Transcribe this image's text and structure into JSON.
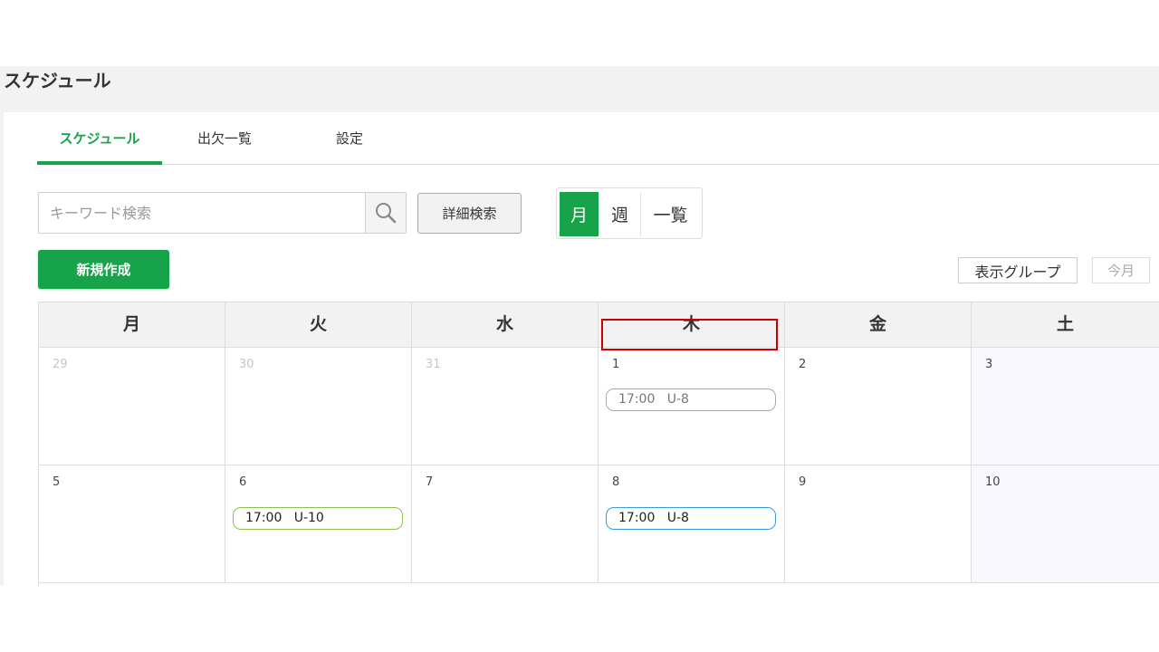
{
  "page": {
    "title": "スケジュール"
  },
  "tabs": [
    {
      "label": "スケジュール",
      "active": true
    },
    {
      "label": "出欠一覧",
      "active": false
    },
    {
      "label": "設定",
      "active": false
    }
  ],
  "search": {
    "placeholder": "キーワード検索",
    "value": "",
    "icon": "search-icon"
  },
  "toolbar": {
    "detail_search_label": "詳細検索",
    "new_label": "新規作成",
    "display_group_label": "表示グループ",
    "today_label": "今月"
  },
  "view_toggle": [
    {
      "label": "月",
      "active": true
    },
    {
      "label": "週",
      "active": false
    },
    {
      "label": "一覧",
      "active": false
    }
  ],
  "calendar": {
    "weekdays": [
      "月",
      "火",
      "水",
      "木",
      "金",
      "土"
    ],
    "weeks": [
      {
        "days": [
          {
            "num": "29",
            "muted": true,
            "events": []
          },
          {
            "num": "30",
            "muted": true,
            "events": []
          },
          {
            "num": "31",
            "muted": true,
            "events": []
          },
          {
            "num": "1",
            "muted": false,
            "events": [
              {
                "time": "17:00",
                "title": "U-8",
                "style": "gray"
              }
            ]
          },
          {
            "num": "2",
            "muted": false,
            "events": []
          },
          {
            "num": "3",
            "muted": false,
            "events": []
          }
        ]
      },
      {
        "days": [
          {
            "num": "5",
            "muted": false,
            "events": []
          },
          {
            "num": "6",
            "muted": false,
            "events": [
              {
                "time": "17:00",
                "title": "U-10",
                "style": "lime"
              }
            ]
          },
          {
            "num": "7",
            "muted": false,
            "events": []
          },
          {
            "num": "8",
            "muted": false,
            "events": [
              {
                "time": "17:00",
                "title": "U-8",
                "style": "blue"
              }
            ]
          },
          {
            "num": "9",
            "muted": false,
            "events": []
          },
          {
            "num": "10",
            "muted": false,
            "events": []
          }
        ]
      }
    ]
  },
  "colors": {
    "accent": "#16a34a",
    "highlight": "#cc0000",
    "event_gray": "#aaaaaa",
    "event_lime": "#8bc34a",
    "event_blue": "#3b9ae1"
  }
}
